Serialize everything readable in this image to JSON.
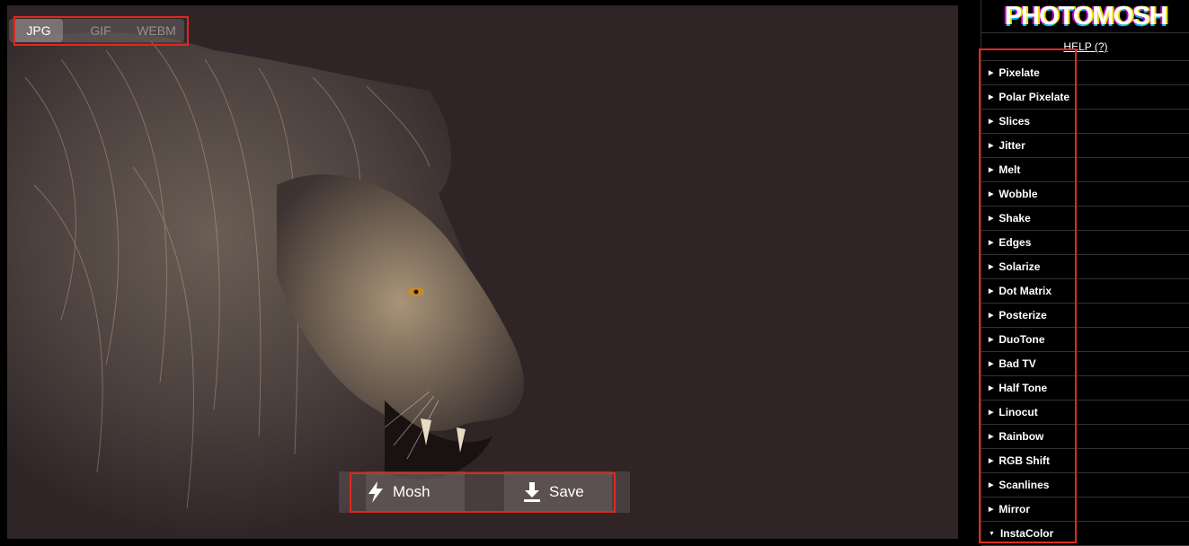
{
  "format_toggle": {
    "options": [
      "JPG",
      "GIF",
      "WEBM"
    ],
    "selected": "JPG"
  },
  "actions": {
    "mosh_label": "Mosh",
    "save_label": "Save"
  },
  "sidebar": {
    "logo": "PHOTOMOSH",
    "help": "HELP (?)",
    "effects": [
      "Pixelate",
      "Polar Pixelate",
      "Slices",
      "Jitter",
      "Melt",
      "Wobble",
      "Shake",
      "Edges",
      "Solarize",
      "Dot Matrix",
      "Posterize",
      "DuoTone",
      "Bad TV",
      "Half Tone",
      "Linocut",
      "Rainbow",
      "RGB Shift",
      "Scanlines",
      "Mirror",
      "InstaColor"
    ],
    "expanded_effect": "InstaColor"
  },
  "colors": {
    "accent_highlight": "#e0281e",
    "canvas_bg": "#2f2527",
    "lion_fur": "#d8c4a2"
  },
  "icons": {
    "mosh": "lightning-bolt-icon",
    "save": "download-icon",
    "effect_collapsed": "triangle-right-icon",
    "effect_expanded": "triangle-down-icon"
  }
}
